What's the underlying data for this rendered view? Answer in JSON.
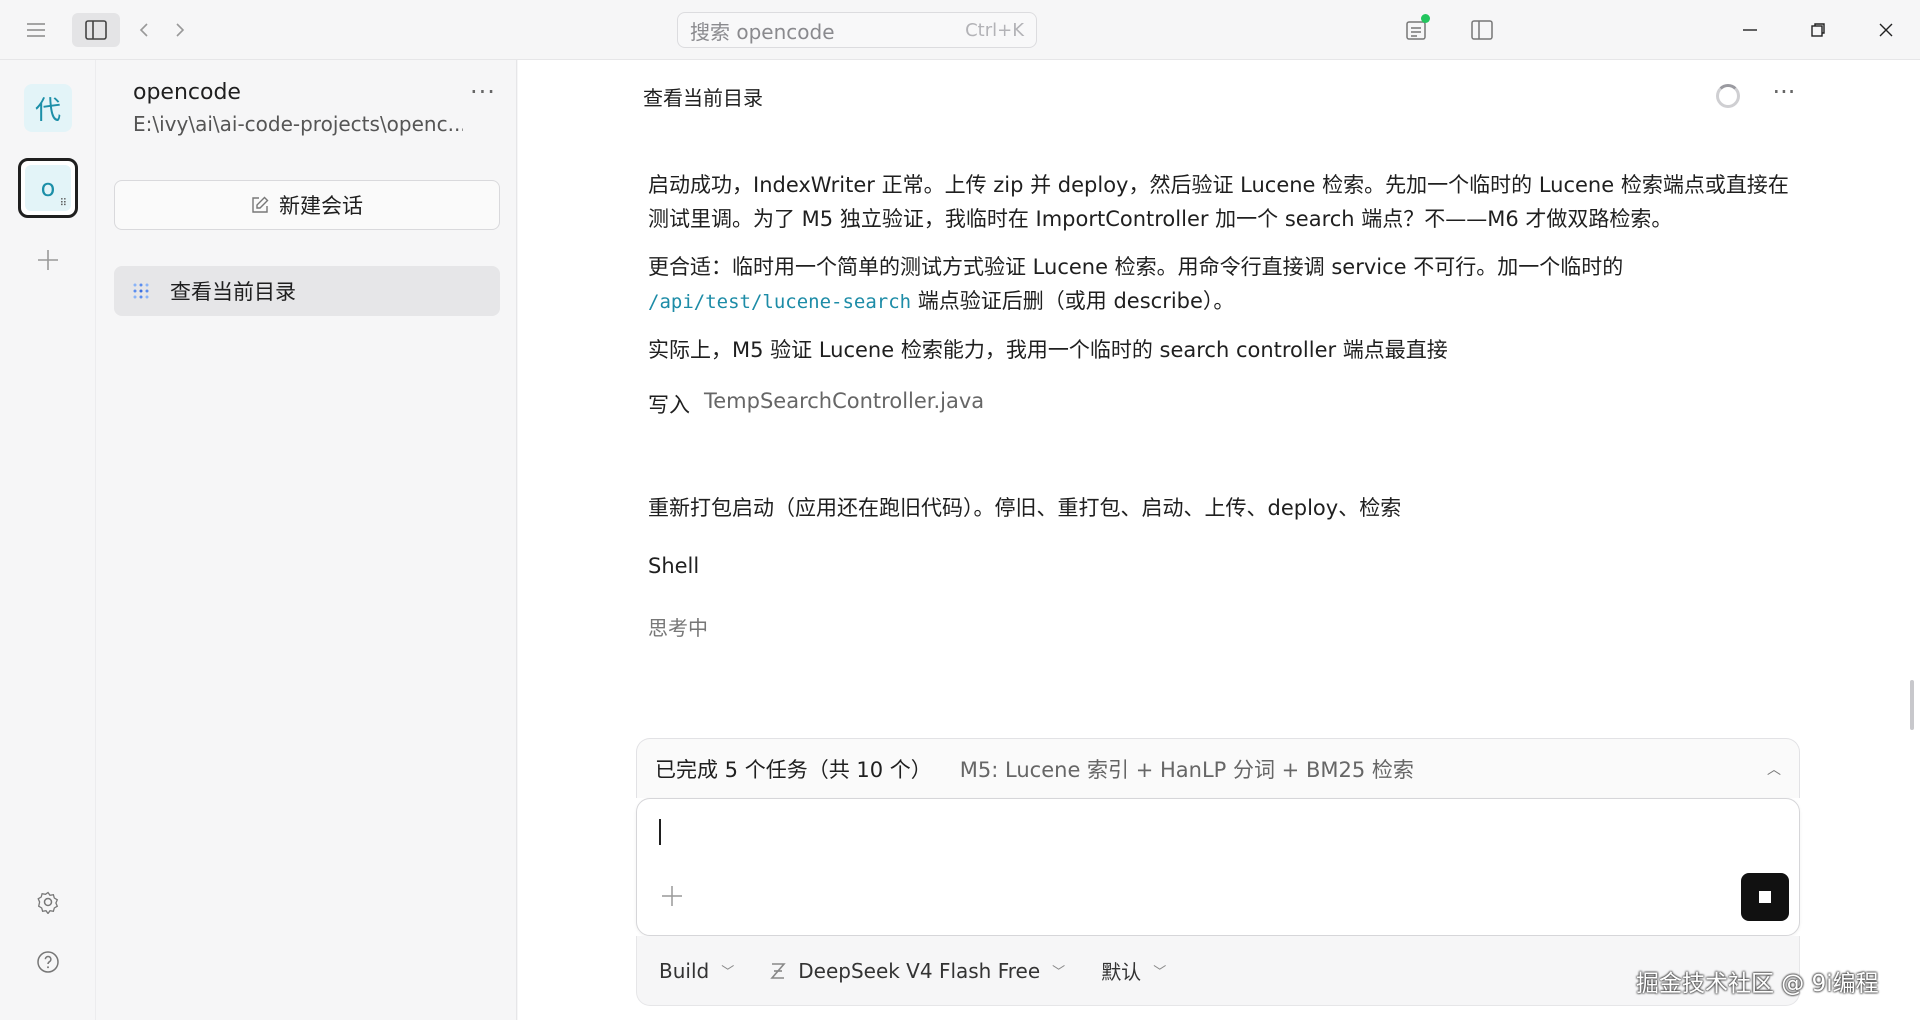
{
  "titlebar": {
    "search_placeholder": "搜索 opencode",
    "search_shortcut": "Ctrl+K",
    "icons": [
      "menu-icon",
      "panel-toggle-icon",
      "chevron-left-icon",
      "chevron-right-icon",
      "review-icon",
      "right-panel-icon",
      "minimize-icon",
      "maximize-icon",
      "close-icon"
    ],
    "status_dot_color": "#22c55e"
  },
  "rail": {
    "project_avatar_1": "代",
    "project_avatar_2": "o"
  },
  "sidebar": {
    "project_name": "opencode",
    "project_path": "E:\\ivy\\ai\\ai-code-projects\\openc...",
    "new_session_label": "新建会话",
    "sessions": [
      {
        "label": "查看当前目录"
      }
    ]
  },
  "main": {
    "title": "查看当前目录",
    "paragraphs": [
      "启动成功，IndexWriter 正常。上传 zip 并 deploy，然后验证 Lucene 检索。先加一个临时的 Lucene 检索端点或直接在测试里调。为了 M5 独立验证，我临时在 ImportController 加一个 search 端点？不——M6 才做双路检索。",
      "更合适：临时用一个简单的测试方式验证 Lucene 检索。用命令行直接调 service 不可行。加一个临时的",
      "实际上，M5 验证 Lucene 检索能力，我用一个临时的 search controller 端点最直接"
    ],
    "code_inline": "/api/test/lucene-search",
    "code_suffix": " 端点验证后删（或用 describe）。",
    "tool_action": "写入",
    "tool_file": "TempSearchController.java",
    "repack_text": "重新打包启动（应用还在跑旧代码）。停旧、重打包、启动、上传、deploy、检索",
    "shell_label": "Shell",
    "thinking_label": "思考中"
  },
  "taskbar": {
    "done_text": "已完成 5 个任务（共 10 个）",
    "current_task": "M5: Lucene 索引 + HanLP 分词 + BM25 检索"
  },
  "composer": {
    "input_value": ""
  },
  "footer": {
    "agent": "Build",
    "model": "DeepSeek V4 Flash Free",
    "variant": "默认"
  },
  "watermark": "掘金技术社区 @ 9i编程",
  "colors": {
    "accent_code": "#1d8ca7",
    "avatar_bg": "#e3f4f8",
    "avatar_fg": "#1c8fa8"
  }
}
